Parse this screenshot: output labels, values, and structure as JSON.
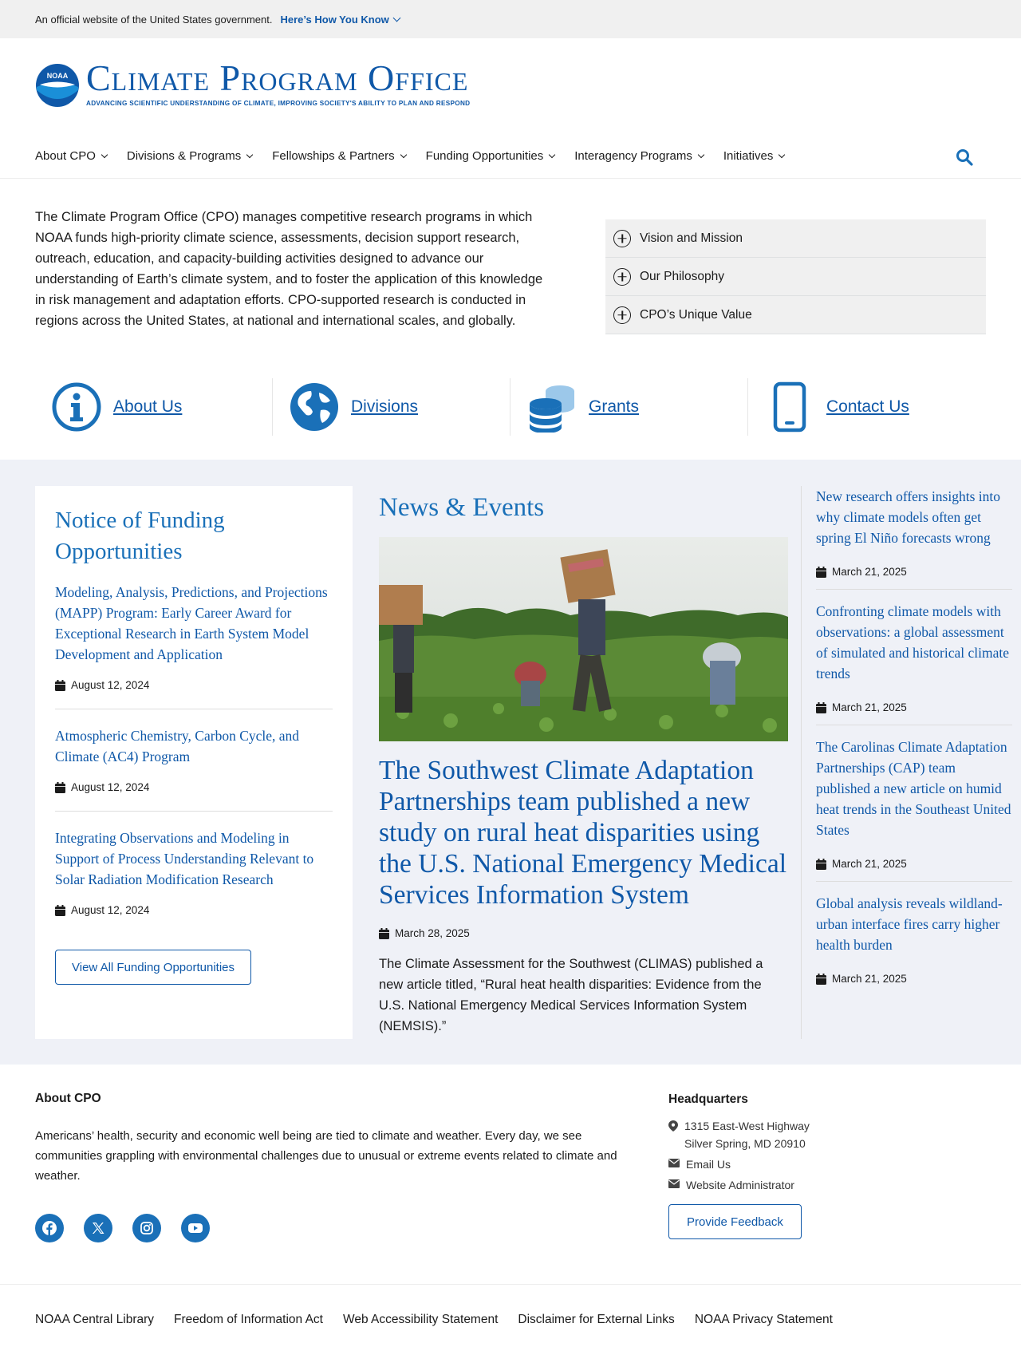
{
  "gov_banner": {
    "official_text": "An official website of the United States government.",
    "how_you_know": "Here’s How You Know"
  },
  "header": {
    "logo_title": "Climate Program Office",
    "logo_tagline": "ADVANCING SCIENTIFIC UNDERSTANDING OF CLIMATE, IMPROVING SOCIETY'S ABILITY TO PLAN AND RESPOND",
    "logo_badge": "NOAA"
  },
  "nav": {
    "items": [
      {
        "label": "About CPO"
      },
      {
        "label": "Divisions & Programs"
      },
      {
        "label": "Fellowships & Partners"
      },
      {
        "label": "Funding Opportunities"
      },
      {
        "label": "Interagency Programs"
      },
      {
        "label": "Initiatives"
      }
    ],
    "search_icon": "search-icon"
  },
  "intro": {
    "text": "The Climate Program Office (CPO) manages competitive research programs in which NOAA funds high-priority climate science, assessments, decision support research, outreach, education, and capacity-building activities designed to advance our understanding of Earth’s climate system, and to foster the application of this knowledge in risk management and adaptation efforts. CPO-supported research is conducted in regions across the United States, at national and international scales, and globally.",
    "accordion": [
      {
        "label": "Vision and Mission"
      },
      {
        "label": "Our Philosophy"
      },
      {
        "label": "CPO’s Unique Value"
      }
    ]
  },
  "quick_links": [
    {
      "label": "About Us",
      "icon": "info-icon"
    },
    {
      "label": "Divisions",
      "icon": "globe-icon"
    },
    {
      "label": "Grants",
      "icon": "coins-icon"
    },
    {
      "label": "Contact Us",
      "icon": "phone-icon"
    }
  ],
  "nofo": {
    "title": "Notice of Funding Opportunities",
    "items": [
      {
        "title": "Modeling, Analysis, Predictions, and Projections (MAPP) Program: Early Career Award for Exceptional Research in Earth System Model Development and Application",
        "date": "August 12, 2024"
      },
      {
        "title": "Atmospheric Chemistry, Carbon Cycle, and Climate (AC4) Program",
        "date": "August 12, 2024"
      },
      {
        "title": "Integrating Observations and Modeling in Support of Process Understanding Relevant to Solar Radiation Modification Research",
        "date": "August 12, 2024"
      }
    ],
    "button": "View All Funding Opportunities"
  },
  "news": {
    "title": "News & Events",
    "headline": "The Southwest Climate Adaptation Partnerships team published a new study on rural heat disparities using the U.S. National Emergency Medical Services Information System",
    "date": "March 28, 2025",
    "body": "The Climate Assessment for the Southwest (CLIMAS) published a new article titled, “Rural heat health disparities: Evidence from the U.S. National Emergency Medical Services Information System (NEMSIS).”"
  },
  "side_news": [
    {
      "title": "New research offers insights into why climate models often get spring El Niño forecasts wrong",
      "date": "March 21, 2025"
    },
    {
      "title": "Confronting climate models with observations: a global assessment of simulated and historical climate trends",
      "date": "March 21, 2025"
    },
    {
      "title": "The Carolinas Climate Adaptation Partnerships (CAP) team published a new article on humid heat trends in the Southeast United States",
      "date": "March 21, 2025"
    },
    {
      "title": "Global analysis reveals wildland-urban interface fires carry higher health burden",
      "date": "March 21, 2025"
    }
  ],
  "footer": {
    "about_title": "About CPO",
    "about_text": "Americans’ health, security and economic well being are tied to climate and weather. Every day, we see communities grappling with environmental challenges due to unusual or extreme events related to climate and weather.",
    "socials": [
      "facebook-icon",
      "x-icon",
      "instagram-icon",
      "youtube-icon"
    ],
    "hq_title": "Headquarters",
    "address_line1": "1315 East-West Highway",
    "address_line2": "Silver Spring, MD 20910",
    "email": "Email Us",
    "webmaster": "Website Administrator",
    "feedback_button": "Provide Feedback",
    "bottom_links": [
      {
        "label": "NOAA Central Library"
      },
      {
        "label": "Freedom of Information Act"
      },
      {
        "label": "Web Accessibility Statement"
      },
      {
        "label": "Disclaimer for External Links"
      },
      {
        "label": "NOAA Privacy Statement"
      }
    ]
  },
  "colors": {
    "brand_blue": "#0f58a8",
    "heading_blue": "#1a70b8",
    "band_bg": "#eff1f7"
  }
}
